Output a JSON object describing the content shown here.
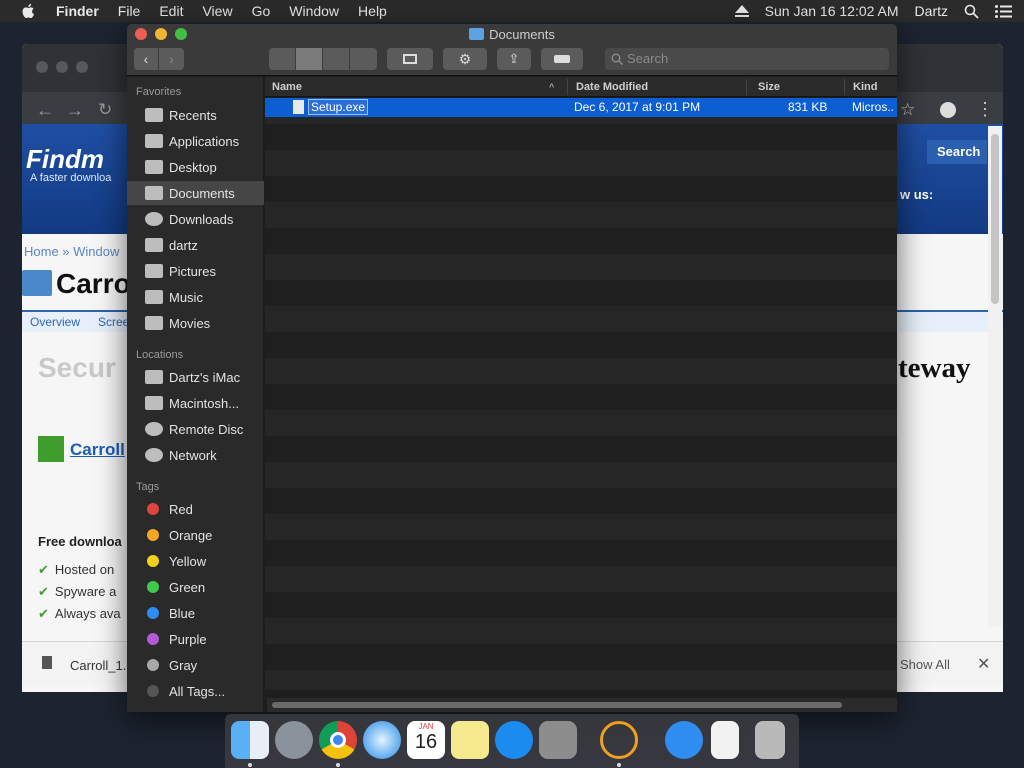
{
  "menubar": {
    "app": "Finder",
    "items": [
      "File",
      "Edit",
      "View",
      "Go",
      "Window",
      "Help"
    ],
    "clock": "Sun Jan 16  12:02 AM",
    "user": "Dartz"
  },
  "browser": {
    "logo": "Findm",
    "tagline": "A faster downloa",
    "breadcrumb": "Home » Window",
    "heading": "Carro",
    "tabs": [
      "Overview",
      "Scree"
    ],
    "secure": "Secur",
    "gateway": "teway",
    "app_link": "Carroll",
    "free_download": "Free downloa",
    "list": [
      "Hosted on",
      "Spyware a",
      "Always ava"
    ],
    "search_button": "Search",
    "follow": "w us:",
    "download_file": "Carroll_1.",
    "show_all": "Show All",
    "close": "✕"
  },
  "finder": {
    "title": "Documents",
    "search_placeholder": "Search",
    "sidebar": {
      "favorites_label": "Favorites",
      "favorites": [
        "Recents",
        "Applications",
        "Desktop",
        "Documents",
        "Downloads",
        "dartz",
        "Pictures",
        "Music",
        "Movies"
      ],
      "selected": "Documents",
      "locations_label": "Locations",
      "locations": [
        "Dartz's iMac",
        "Macintosh...",
        "Remote Disc",
        "Network"
      ],
      "tags_label": "Tags",
      "tags": [
        {
          "name": "Red",
          "color": "#e0443e"
        },
        {
          "name": "Orange",
          "color": "#f5a623"
        },
        {
          "name": "Yellow",
          "color": "#f3d11b"
        },
        {
          "name": "Green",
          "color": "#3fc84a"
        },
        {
          "name": "Blue",
          "color": "#2f8cf0"
        },
        {
          "name": "Purple",
          "color": "#b459d6"
        },
        {
          "name": "Gray",
          "color": "#a8a8a8"
        }
      ],
      "all_tags": "All Tags..."
    },
    "columns": {
      "name": "Name",
      "date": "Date Modified",
      "size": "Size",
      "kind": "Kind"
    },
    "files": [
      {
        "name": "Setup.exe",
        "date": "Dec 6, 2017 at 9:01 PM",
        "size": "831 KB",
        "kind": "Micros.."
      }
    ]
  },
  "dock": {
    "calendar_month": "JAN",
    "calendar_day": "16"
  }
}
